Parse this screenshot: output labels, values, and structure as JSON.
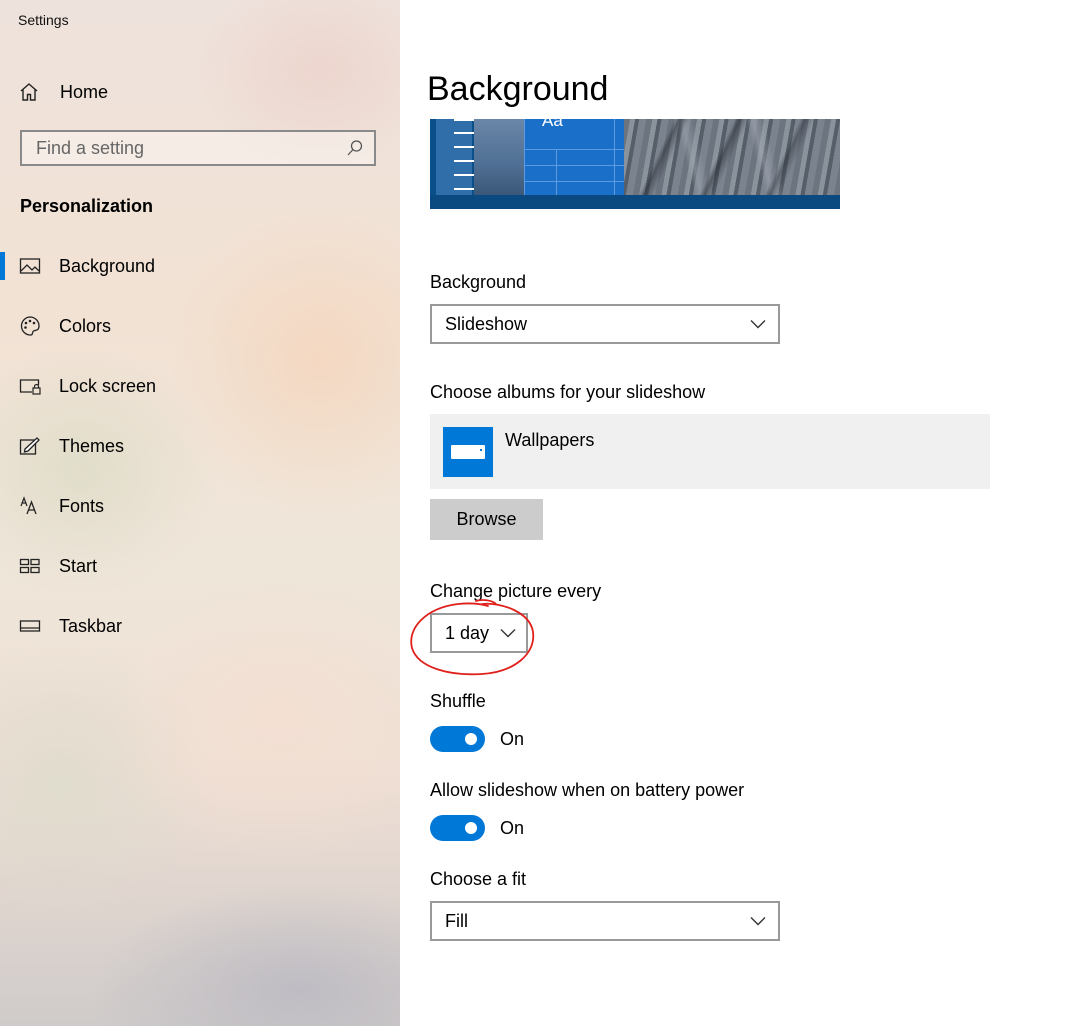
{
  "window": {
    "title": "Settings"
  },
  "sidebar": {
    "home_label": "Home",
    "search_placeholder": "Find a setting",
    "section_heading": "Personalization",
    "items": [
      {
        "label": "Background",
        "icon": "picture-icon",
        "selected": true
      },
      {
        "label": "Colors",
        "icon": "palette-icon",
        "selected": false
      },
      {
        "label": "Lock screen",
        "icon": "lock-screen-icon",
        "selected": false
      },
      {
        "label": "Themes",
        "icon": "themes-icon",
        "selected": false
      },
      {
        "label": "Fonts",
        "icon": "fonts-icon",
        "selected": false
      },
      {
        "label": "Start",
        "icon": "start-icon",
        "selected": false
      },
      {
        "label": "Taskbar",
        "icon": "taskbar-icon",
        "selected": false
      }
    ]
  },
  "main": {
    "title": "Background",
    "preview": {
      "sample_text": "Aa"
    },
    "background": {
      "label": "Background",
      "value": "Slideshow"
    },
    "albums": {
      "label": "Choose albums for your slideshow",
      "album_name": "Wallpapers"
    },
    "browse_label": "Browse",
    "change_picture": {
      "label": "Change picture every",
      "value": "1 day"
    },
    "shuffle": {
      "label": "Shuffle",
      "state": "On",
      "on": true
    },
    "battery": {
      "label": "Allow slideshow when on battery power",
      "state": "On",
      "on": true
    },
    "fit": {
      "label": "Choose a fit",
      "value": "Fill"
    }
  },
  "colors": {
    "accent": "#0078d7",
    "annotation": "#e0201b"
  }
}
